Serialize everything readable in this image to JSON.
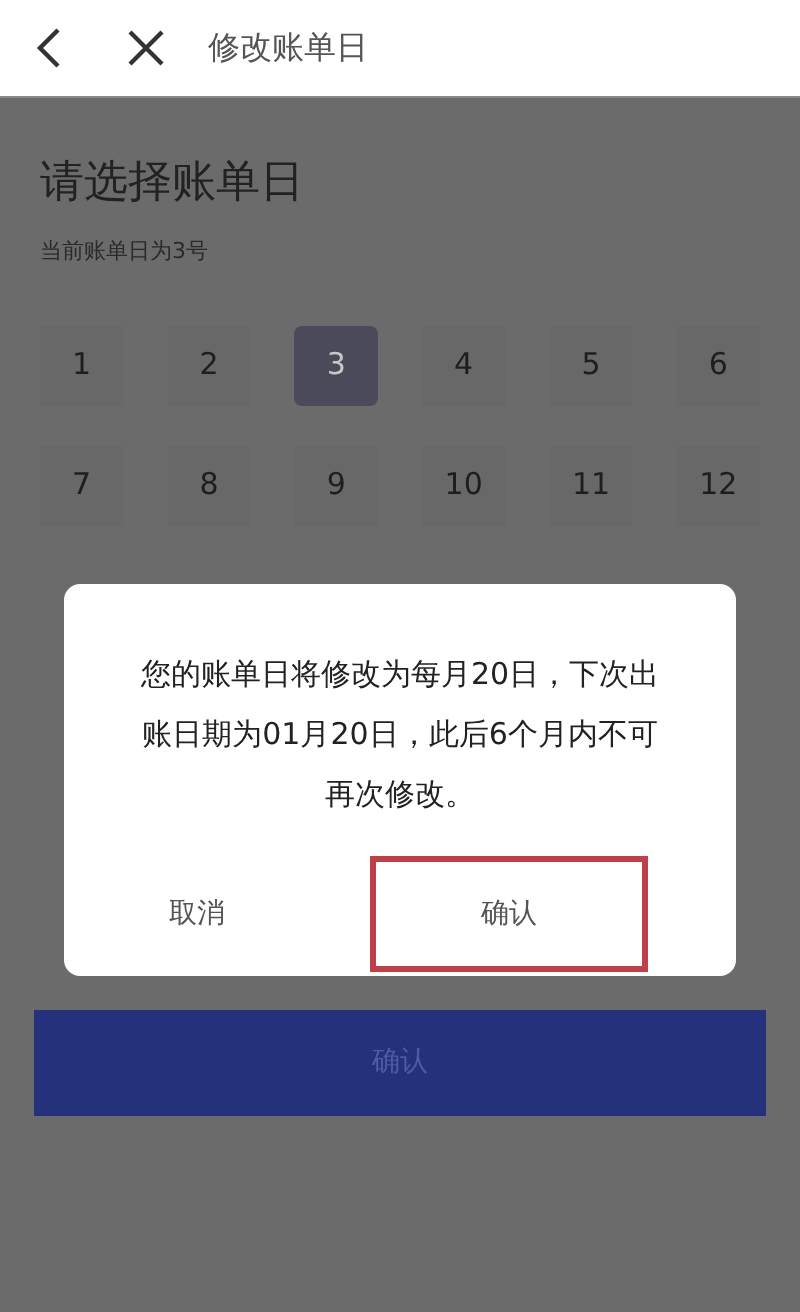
{
  "header": {
    "title": "修改账单日"
  },
  "page": {
    "title": "请选择账单日",
    "subtitle": "当前账单日为3号"
  },
  "days": [
    {
      "label": "1",
      "selected": false
    },
    {
      "label": "2",
      "selected": false
    },
    {
      "label": "3",
      "selected": true
    },
    {
      "label": "4",
      "selected": false
    },
    {
      "label": "5",
      "selected": false
    },
    {
      "label": "6",
      "selected": false
    },
    {
      "label": "7",
      "selected": false
    },
    {
      "label": "8",
      "selected": false
    },
    {
      "label": "9",
      "selected": false
    },
    {
      "label": "10",
      "selected": false
    },
    {
      "label": "11",
      "selected": false
    },
    {
      "label": "12",
      "selected": false
    }
  ],
  "confirm_button": "确认",
  "dialog": {
    "message": "您的账单日将修改为每月20日，下次出账日期为01月20日，此后6个月内不可再次修改。",
    "buttons": [
      {
        "label": "取消",
        "highlighted": false
      },
      {
        "label": "确认",
        "highlighted": true
      }
    ]
  }
}
